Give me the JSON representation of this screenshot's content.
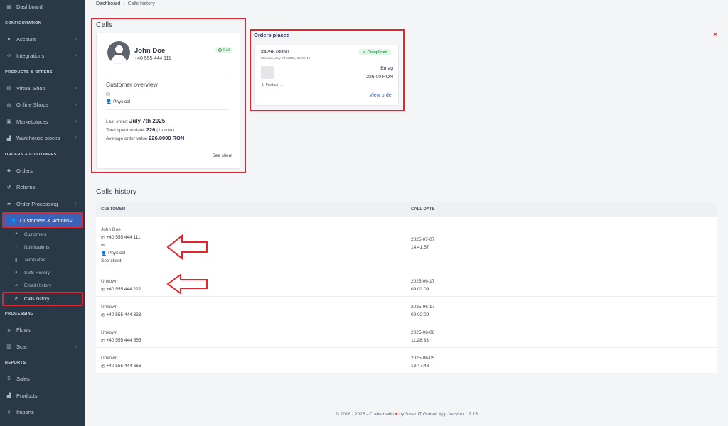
{
  "sidebar": {
    "items": [
      {
        "type": "item",
        "label": "Dashboard",
        "icon": "dashboard-icon",
        "glyph": "▦"
      },
      {
        "type": "section",
        "label": "CONFIGURATION"
      },
      {
        "type": "item",
        "label": "Account",
        "icon": "user-icon",
        "glyph": "●",
        "chevron": true
      },
      {
        "type": "item",
        "label": "Integrations",
        "icon": "link-icon",
        "glyph": "∞",
        "chevron": true
      },
      {
        "type": "section",
        "label": "PRODUCTS & OFFERS"
      },
      {
        "type": "item",
        "label": "Virtual Shop",
        "icon": "shop-icon",
        "glyph": "▤",
        "chevron": true
      },
      {
        "type": "item",
        "label": "Online Shops",
        "icon": "globe-icon",
        "glyph": "◍",
        "chevron": true
      },
      {
        "type": "item",
        "label": "Marketplaces",
        "icon": "marketplace-icon",
        "glyph": "▣",
        "chevron": true
      },
      {
        "type": "item",
        "label": "Warehouse stocks",
        "icon": "boxes-icon",
        "glyph": "▟",
        "chevron": true
      },
      {
        "type": "section",
        "label": "ORDERS & CUSTOMERS"
      },
      {
        "type": "item",
        "label": "Orders",
        "icon": "tag-icon",
        "glyph": "◆"
      },
      {
        "type": "item",
        "label": "Returns",
        "icon": "undo-icon",
        "glyph": "↺"
      },
      {
        "type": "item",
        "label": "Order Processing",
        "icon": "truck-icon",
        "glyph": "▰",
        "chevron": true
      },
      {
        "type": "active",
        "label": "Customers & Actions",
        "icon": "users-icon",
        "glyph": "👥",
        "chevron": true
      },
      {
        "type": "sub",
        "label": "Customers",
        "icon": "users-icon",
        "glyph": "ꔹ"
      },
      {
        "type": "sub",
        "label": "Notifications",
        "icon": "bell-icon",
        "glyph": "◌"
      },
      {
        "type": "sub",
        "label": "Templates",
        "icon": "file-icon",
        "glyph": "▮"
      },
      {
        "type": "sub",
        "label": "SMS History",
        "icon": "sms-icon",
        "glyph": "●"
      },
      {
        "type": "sub",
        "label": "Email History",
        "icon": "inbox-icon",
        "glyph": "⌓"
      },
      {
        "type": "sub-active",
        "label": "Calls history",
        "icon": "phone-icon",
        "glyph": "✆"
      },
      {
        "type": "section",
        "label": "PROCESSING"
      },
      {
        "type": "item",
        "label": "Flows",
        "icon": "flows-icon",
        "glyph": "⋔"
      },
      {
        "type": "item",
        "label": "Scan",
        "icon": "barcode-icon",
        "glyph": "▥",
        "chevron": true
      },
      {
        "type": "section",
        "label": "REPORTS"
      },
      {
        "type": "item",
        "label": "Sales",
        "icon": "dollar-icon",
        "glyph": "$"
      },
      {
        "type": "item",
        "label": "Products",
        "icon": "boxes-icon",
        "glyph": "▟"
      },
      {
        "type": "item",
        "label": "Imports",
        "icon": "upload-icon",
        "glyph": "⇪"
      }
    ]
  },
  "breadcrumb": {
    "home": "Dashboard",
    "current": "Calls history"
  },
  "calls": {
    "title": "Calls",
    "name": "John Doe",
    "phone": "+40 555 444 111",
    "badge": "Call",
    "overview_title": "Customer overview",
    "type": "Physical",
    "last_order_label": "Last order:",
    "last_order_value": "July 7th 2025",
    "total_label": "Total spent to date:",
    "total_value": "226",
    "total_suffix": "(1 order)",
    "avg_label": "Average order value",
    "avg_value": "226.0000 RON",
    "see_client": "See client"
  },
  "orders": {
    "title": "Orders placed",
    "order_number": "#429878050",
    "date": "Monday, July 7th 2025, 12:02:46",
    "status": "Completed",
    "marketplace": "Emag",
    "amount": "226.00 RON",
    "product_qty": "1",
    "product_label": "Product",
    "view_order": "View order"
  },
  "history": {
    "title": "Calls history",
    "col_customer": "CUSTOMER",
    "col_date": "CALL DATE",
    "rows": [
      {
        "name": "John Doe",
        "phone": "+40 555 444 111",
        "type": "Physical",
        "see": "See client",
        "date": "2025-07-07",
        "time": "14:41:57"
      },
      {
        "name": "Unkown",
        "phone": "+40 555 444 222",
        "date": "2025-06-17",
        "time": "09:02:09"
      },
      {
        "name": "Unkown",
        "phone": "+40 555 444 333",
        "date": "2025-06-17",
        "time": "09:02:09"
      },
      {
        "name": "Unkown",
        "phone": "+40 555 444 555",
        "date": "2025-06-06",
        "time": "11:28:33"
      },
      {
        "name": "Unkown",
        "phone": "+40 555 444 666",
        "date": "2025-06-05",
        "time": "13:47:43"
      }
    ]
  },
  "footer": {
    "pre": "© 2018 - 2025 - Crafted with",
    "post": "by SmartIT Global. App Version 1.2.15"
  },
  "colors": {
    "annotation": "#e3262d",
    "sidebar": "#2a3947",
    "accent": "#3c62b8",
    "success": "#2f9a52"
  }
}
